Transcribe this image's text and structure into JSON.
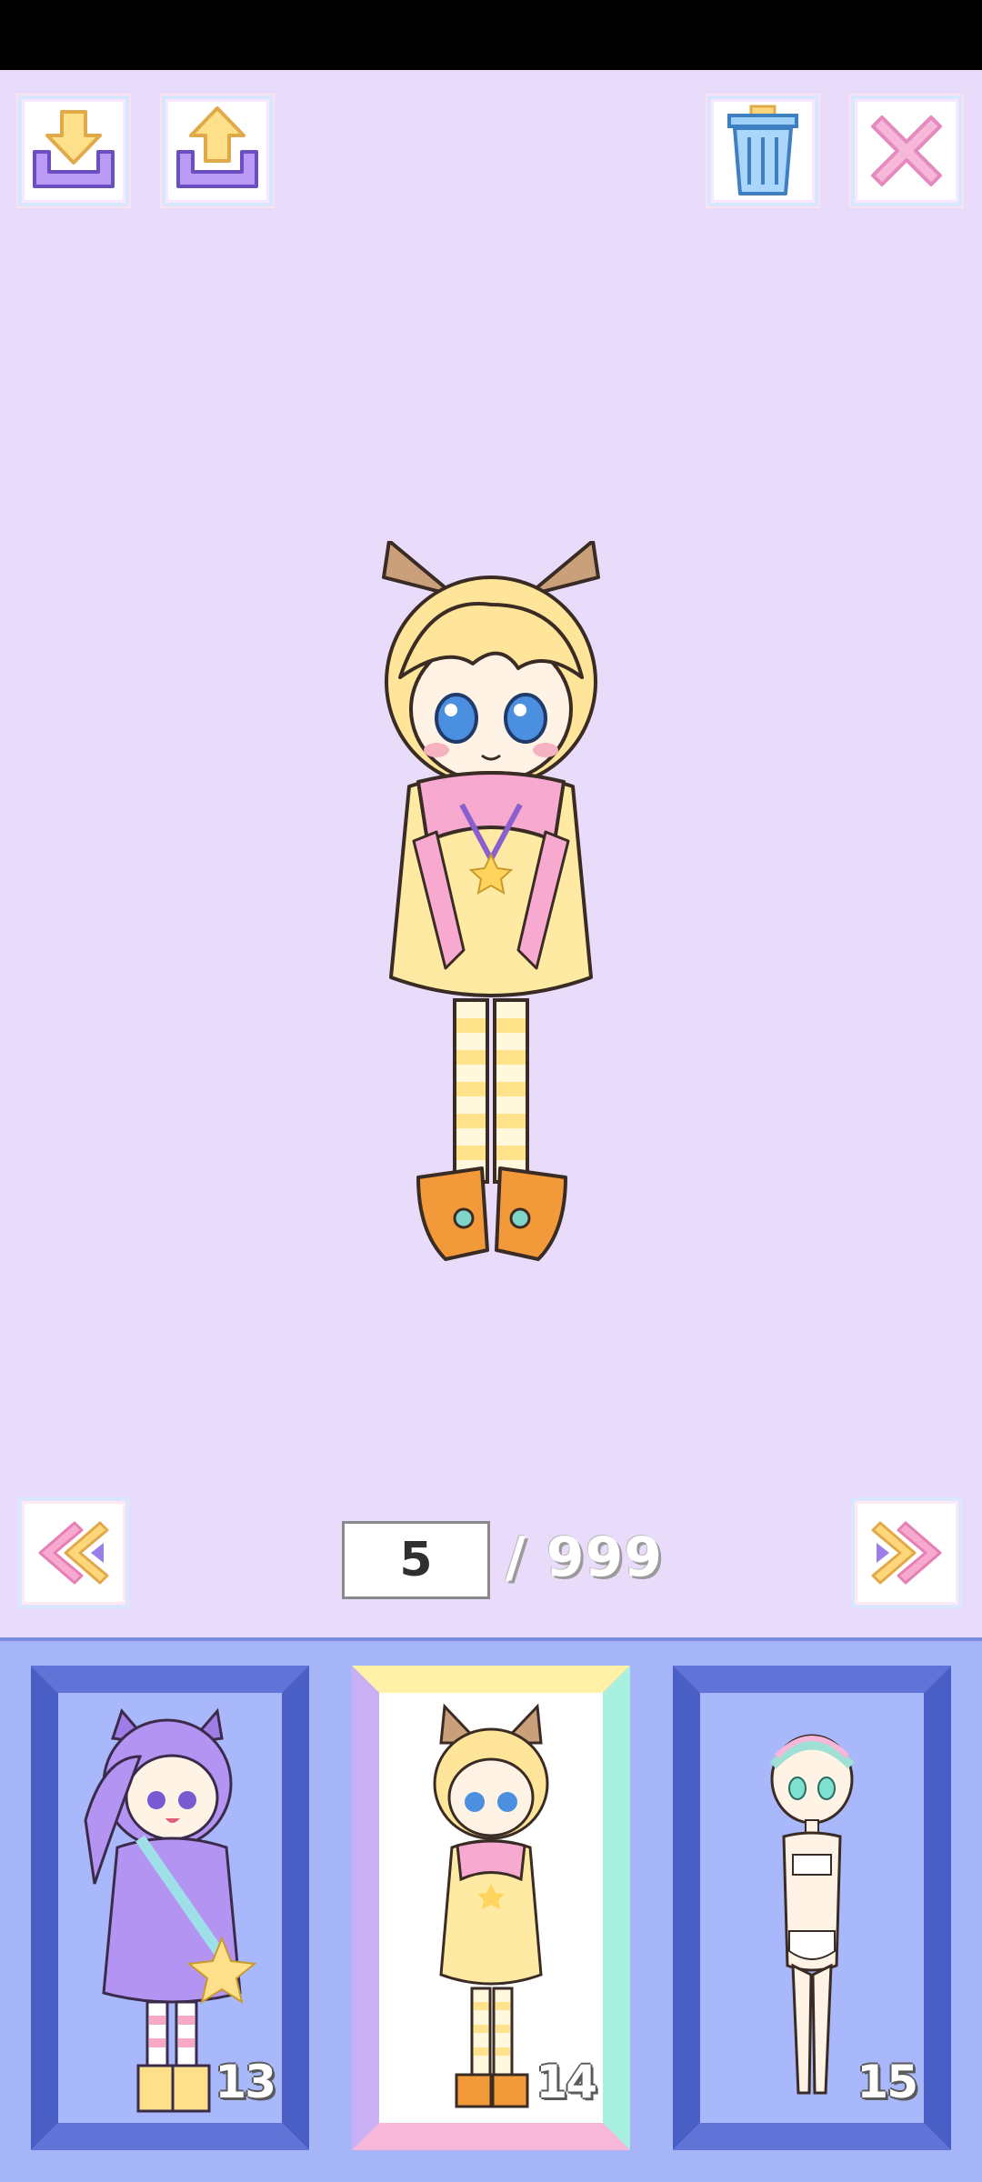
{
  "toolbar": {
    "buttons": [
      {
        "name": "download-button",
        "icon": "download-tray-icon"
      },
      {
        "name": "upload-button",
        "icon": "upload-tray-icon"
      },
      {
        "name": "delete-button",
        "icon": "trash-icon"
      },
      {
        "name": "close-button",
        "icon": "close-x-icon"
      }
    ]
  },
  "pager": {
    "current_page": "5",
    "total_label": "/ 999",
    "prev_icon": "double-chevron-left-icon",
    "next_icon": "double-chevron-right-icon"
  },
  "slots": [
    {
      "number": "13",
      "selected": false
    },
    {
      "number": "14",
      "selected": true
    },
    {
      "number": "15",
      "selected": false
    }
  ],
  "colors": {
    "stage_background": "#e9dcfb",
    "tray_background": "#a6b4f8",
    "slot_frame": "#5f74d6",
    "accent_yellow": "#ffe9a3",
    "accent_purple": "#a88cf0",
    "accent_pink": "#f4a3d6"
  }
}
